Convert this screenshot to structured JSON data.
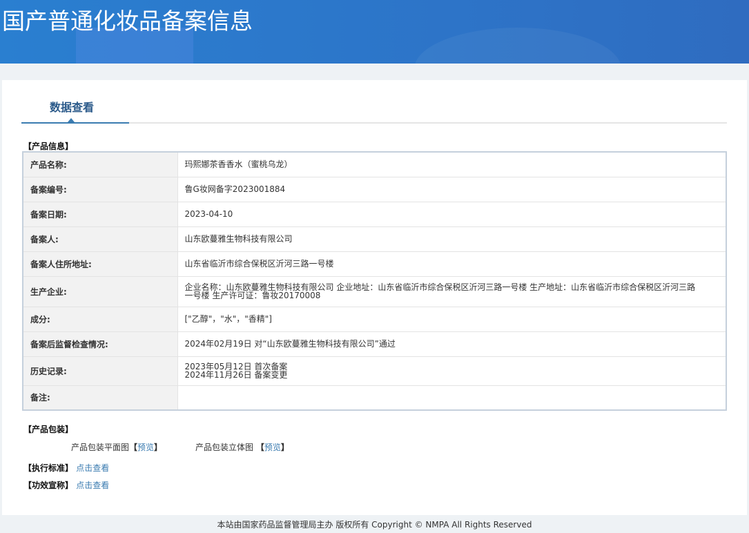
{
  "header": {
    "title": "国产普通化妆品备案信息"
  },
  "tabs": [
    {
      "label": "数据查看",
      "active": true
    }
  ],
  "product_info": {
    "section_label": "【产品信息】",
    "rows": [
      {
        "label": "产品名称:",
        "value": "玛熙娜茶香香水（蜜桃乌龙）"
      },
      {
        "label": "备案编号:",
        "value": "鲁G妆网备字2023001884"
      },
      {
        "label": "备案日期:",
        "value": "2023-04-10"
      },
      {
        "label": "备案人:",
        "value": "山东欧蔓雅生物科技有限公司"
      },
      {
        "label": "备案人住所地址:",
        "value": "山东省临沂市综合保税区沂河三路一号楼"
      },
      {
        "label": "生产企业:",
        "value": "企业名称：山东欧蔓雅生物科技有限公司 企业地址：山东省临沂市综合保税区沂河三路一号楼 生产地址：山东省临沂市综合保税区沂河三路一号楼 生产许可证：鲁妆20170008"
      },
      {
        "label": "成分:",
        "value": "[\"乙醇\"，\"水\"，\"香精\"]"
      },
      {
        "label": "备案后监督检查情况:",
        "value": "2024年02月19日 对“山东欧蔓雅生物科技有限公司”通过"
      },
      {
        "label": "历史记录:",
        "value": "2023年05月12日 首次备案",
        "value2": "2024年11月26日 备案变更"
      },
      {
        "label": "备注:",
        "value": ""
      }
    ]
  },
  "packaging": {
    "section_label": "【产品包装】",
    "flat_label": "产品包装平面图",
    "three_d_label": "产品包装立体图",
    "preview_link": "预览",
    "open_bracket": "【",
    "close_bracket": "】"
  },
  "standard": {
    "label": "【执行标准】",
    "link": "点击查看"
  },
  "efficacy": {
    "label": "【功效宣称】",
    "link": "点击查看"
  },
  "footer": {
    "text": "本站由国家药品监督管理局主办 版权所有 Copyright © NMPA All Rights Reserved"
  },
  "colors": {
    "banner": "#2d74c8",
    "link": "#3a7bb0",
    "tab_text": "#2b5a8a"
  }
}
